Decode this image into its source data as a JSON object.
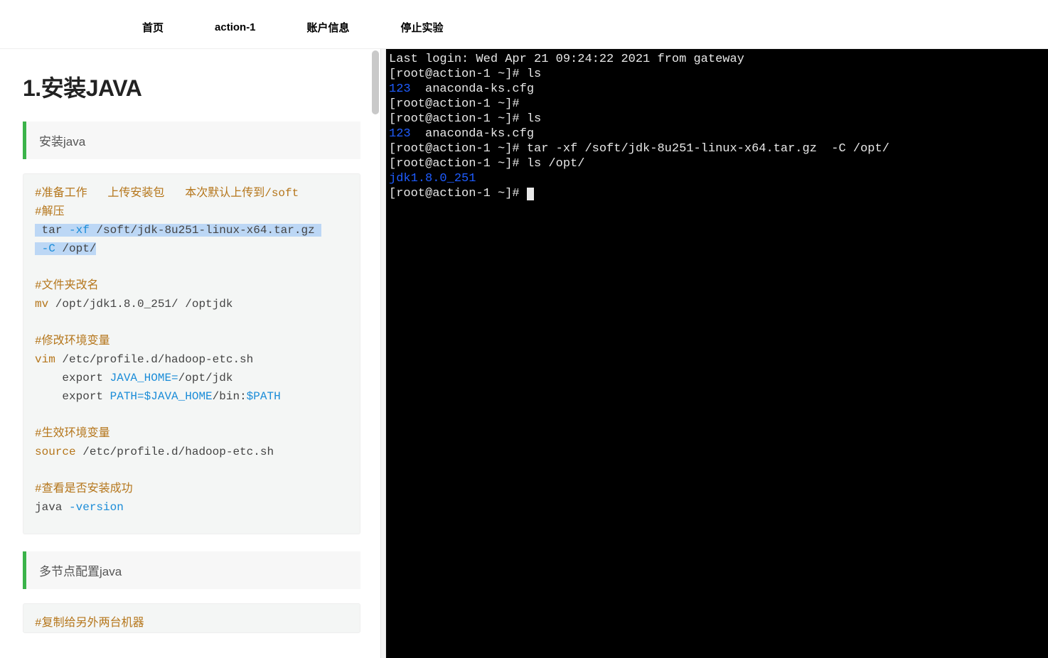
{
  "nav": {
    "home": "首页",
    "action": "action-1",
    "account": "账户信息",
    "stop": "停止实验"
  },
  "left": {
    "heading": "1.安装JAVA",
    "section1": "安装java",
    "section2": "多节点配置java",
    "code": {
      "c1": "#准备工作   上传安装包   本次默认上传到",
      "c1b": "/soft",
      "c2": "#解压",
      "l3a": " tar ",
      "l3b": "-xf",
      "l3c": " /soft/jdk-8u251-linux-x64.tar.gz ",
      "l4a": " -C",
      "l4b": " /opt/",
      "c5": "#文件夹改名",
      "l6a": "mv",
      "l6b": " /opt/jdk1.8.0_251/ /optjdk",
      "c7": "#修改环境变量",
      "l8a": "vim",
      "l8b": " /etc/profile.d/hadoop-etc.sh",
      "l9a": "    export ",
      "l9b": "JAVA_HOME=",
      "l9c": "/opt/jdk",
      "l10a": "    export ",
      "l10b": "PATH=$JAVA_HOME",
      "l10c": "/bin:",
      "l10d": "$PATH",
      "c11": "#生效环境变量",
      "l12a": "source",
      "l12b": " /etc/profile.d/hadoop-etc.sh",
      "c13": "#查看是否安装成功",
      "l14a": "java ",
      "l14b": "-version"
    },
    "code2_c1": "#复制给另外两台机器"
  },
  "terminal": {
    "l1": "Last login: Wed Apr 21 09:24:22 2021 from gateway",
    "l2": "[root@action-1 ~]# ls",
    "l3a": "123",
    "l3b": "  anaconda-ks.cfg",
    "l4": "[root@action-1 ~]# ",
    "l5": "[root@action-1 ~]# ls",
    "l6a": "123",
    "l6b": "  anaconda-ks.cfg",
    "l7": "[root@action-1 ~]# tar -xf /soft/jdk-8u251-linux-x64.tar.gz  -C /opt/",
    "l8": "[root@action-1 ~]# ls /opt/",
    "l9": "jdk1.8.0_251",
    "l10": "[root@action-1 ~]# "
  }
}
